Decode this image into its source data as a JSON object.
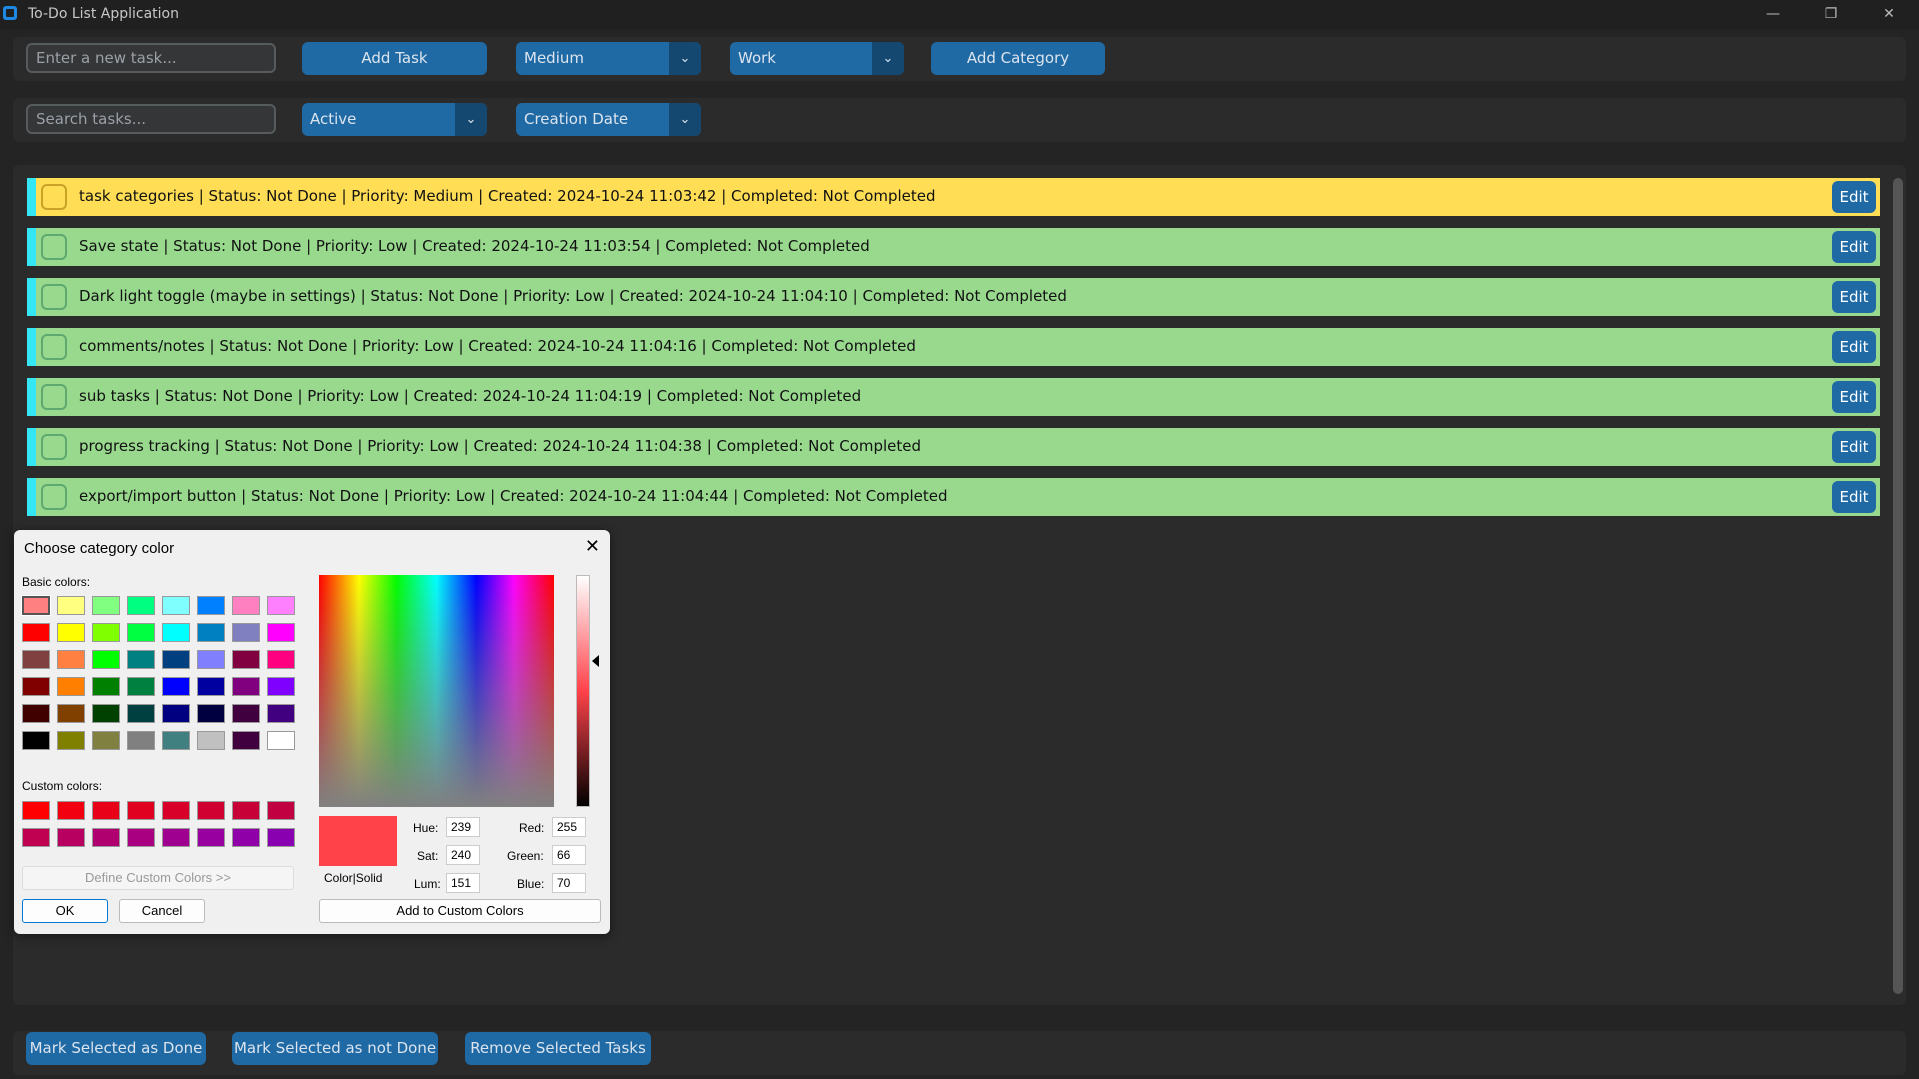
{
  "window": {
    "title": "To-Do List Application",
    "controls": {
      "minimize": "—",
      "maximize": "❐",
      "close": "✕"
    }
  },
  "toolbar": {
    "new_task_placeholder": "Enter a new task...",
    "add_task_label": "Add Task",
    "priority_value": "Medium",
    "category_value": "Work",
    "add_category_label": "Add Category",
    "search_placeholder": "Search tasks...",
    "filter_value": "Active",
    "sort_value": "Creation Date",
    "dropdown_arrow": "⌄"
  },
  "tasks": [
    {
      "text": "task categories | Status: Not Done | Priority: Medium | Created: 2024-10-24 11:03:42 | Completed: Not Completed",
      "edit_label": "Edit",
      "color": "#ffdd55"
    },
    {
      "text": "Save state | Status: Not Done | Priority: Low | Created: 2024-10-24 11:03:54 | Completed: Not Completed",
      "edit_label": "Edit",
      "color": "#98d98e"
    },
    {
      "text": "Dark light toggle (maybe in settings) | Status: Not Done | Priority: Low | Created: 2024-10-24 11:04:10 | Completed: Not Completed",
      "edit_label": "Edit",
      "color": "#98d98e"
    },
    {
      "text": "comments/notes | Status: Not Done | Priority: Low | Created: 2024-10-24 11:04:16 | Completed: Not Completed",
      "edit_label": "Edit",
      "color": "#98d98e"
    },
    {
      "text": "sub tasks | Status: Not Done | Priority: Low | Created: 2024-10-24 11:04:19 | Completed: Not Completed",
      "edit_label": "Edit",
      "color": "#98d98e"
    },
    {
      "text": "progress tracking | Status: Not Done | Priority: Low | Created: 2024-10-24 11:04:38 | Completed: Not Completed",
      "edit_label": "Edit",
      "color": "#98d98e"
    },
    {
      "text": "export/import button | Status: Not Done | Priority: Low | Created: 2024-10-24 11:04:44 | Completed: Not Completed",
      "edit_label": "Edit",
      "color": "#98d98e"
    }
  ],
  "bottom": {
    "mark_done": "Mark Selected as Done",
    "mark_not_done": "Mark Selected as not Done",
    "remove": "Remove Selected Tasks"
  },
  "color_dialog": {
    "title": "Choose category color",
    "close": "✕",
    "basic_colors_label": "Basic colors:",
    "custom_colors_label": "Custom colors:",
    "define_custom": "Define Custom Colors >>",
    "ok": "OK",
    "cancel": "Cancel",
    "add_custom": "Add to Custom Colors",
    "color_solid_label": "Color|Solid",
    "hue_label": "Hue:",
    "hue": "239",
    "sat_label": "Sat:",
    "sat": "240",
    "lum_label": "Lum:",
    "lum": "151",
    "red_label": "Red:",
    "red": "255",
    "green_label": "Green:",
    "green": "66",
    "blue_label": "Blue:",
    "blue": "70",
    "current_color": "#ff424a",
    "basic_colors": [
      "#ff8080",
      "#ffff80",
      "#80ff80",
      "#00ff80",
      "#80ffff",
      "#0080ff",
      "#ff80c0",
      "#ff80ff",
      "#ff0000",
      "#ffff00",
      "#80ff00",
      "#00ff40",
      "#00ffff",
      "#0080c0",
      "#8080c0",
      "#ff00ff",
      "#804040",
      "#ff8040",
      "#00ff00",
      "#008080",
      "#004080",
      "#8080ff",
      "#800040",
      "#ff0080",
      "#800000",
      "#ff8000",
      "#008000",
      "#008040",
      "#0000ff",
      "#0000a0",
      "#800080",
      "#8000ff",
      "#400000",
      "#804000",
      "#004000",
      "#004040",
      "#000080",
      "#000040",
      "#400040",
      "#400080",
      "#000000",
      "#808000",
      "#808040",
      "#808080",
      "#408080",
      "#c0c0c0",
      "#400040",
      "#ffffff"
    ],
    "custom_colors": [
      "#ff0000",
      "#f20010",
      "#e80018",
      "#e00020",
      "#d80028",
      "#d00030",
      "#c80038",
      "#c00040",
      "#c00050",
      "#b80060",
      "#b00070",
      "#a80080",
      "#a00090",
      "#9800a0",
      "#9000a8",
      "#8800b0"
    ]
  }
}
